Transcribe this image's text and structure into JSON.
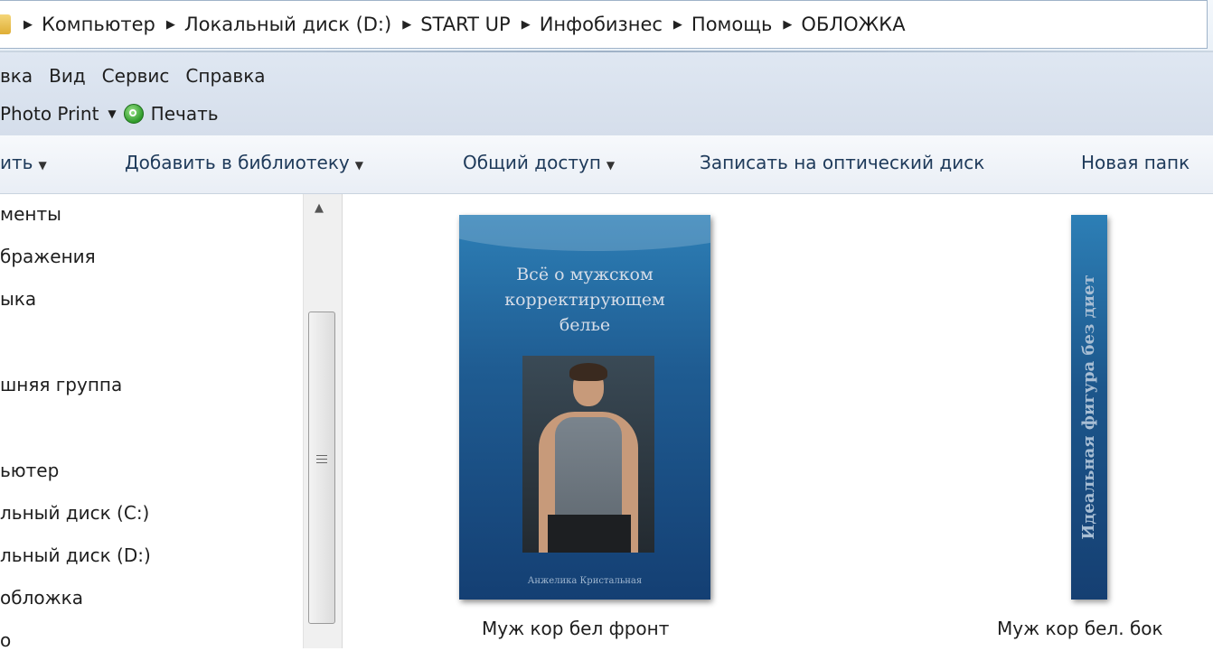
{
  "address": {
    "crumbs": [
      "Компьютер",
      "Локальный диск (D:)",
      "START UP",
      "Инфобизнес",
      "Помощь",
      "ОБЛОЖКА"
    ]
  },
  "menu": [
    "вка",
    "Вид",
    "Сервис",
    "Справка"
  ],
  "photo_print": {
    "label": "Photo Print",
    "print_label": "Печать"
  },
  "commands": [
    {
      "label": "ить",
      "dropdown": true
    },
    {
      "label": "Добавить в библиотеку",
      "dropdown": true
    },
    {
      "label": "Общий доступ",
      "dropdown": true
    },
    {
      "label": "Записать на оптический диск",
      "dropdown": false
    },
    {
      "label": "Новая папк",
      "dropdown": false
    }
  ],
  "nav_items": [
    "менты",
    "бражения",
    "ыка",
    "шняя группа",
    "ьютер",
    "льный диск (C:)",
    "льный диск (D:)",
    "обложка",
    "о"
  ],
  "files": [
    {
      "name": "Муж кор бел фронт",
      "cover_title": "Всё о мужском\nкорректирующем\nбелье",
      "cover_author": "Анжелика Кристальная"
    },
    {
      "name": "Муж кор бел. бок",
      "spine_text": "Идеальная фигура без диет"
    }
  ]
}
